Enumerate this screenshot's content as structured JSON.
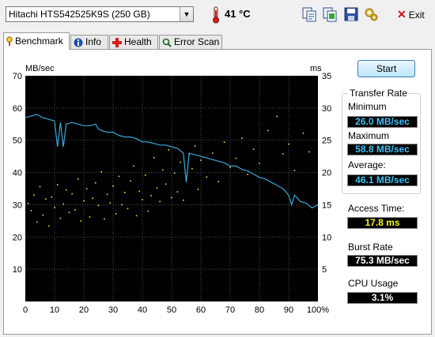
{
  "toolbar": {
    "drive": "Hitachi HTS542525K9S (250 GB)",
    "temperature": "41 °C",
    "icons": [
      "copy-text-icon",
      "copy-screenshot-icon",
      "save-icon",
      "options-icon"
    ],
    "exit_label": "Exit"
  },
  "tabs": [
    {
      "label": "Benchmark",
      "icon": "benchmark-icon",
      "active": true
    },
    {
      "label": "Info",
      "icon": "info-icon",
      "active": false
    },
    {
      "label": "Health",
      "icon": "health-icon",
      "active": false
    },
    {
      "label": "Error Scan",
      "icon": "error-scan-icon",
      "active": false
    }
  ],
  "start_label": "Start",
  "transfer_rate": {
    "title": "Transfer Rate",
    "minimum_label": "Minimum",
    "minimum": "26.0 MB/sec",
    "maximum_label": "Maximum",
    "maximum": "58.8 MB/sec",
    "average_label": "Average:",
    "average": "46.1 MB/sec"
  },
  "access_time_label": "Access Time:",
  "access_time": "17.8 ms",
  "burst_rate_label": "Burst Rate",
  "burst_rate": "75.3 MB/sec",
  "cpu_usage_label": "CPU Usage",
  "cpu_usage": "3.1%",
  "colors": {
    "transfer_line": "#3fa9d8",
    "access_dots": "#e6e62a",
    "plot_background": "#000000",
    "grid": "#2f5a5a"
  },
  "chart_data": {
    "type": "line",
    "xlabel": "",
    "ylabel_left": "MB/sec",
    "ylabel_right": "ms",
    "x_ticks": [
      "0",
      "10",
      "20",
      "30",
      "40",
      "50",
      "60",
      "70",
      "80",
      "90",
      "100%"
    ],
    "y_left_ticks": [
      "10",
      "20",
      "30",
      "40",
      "50",
      "60",
      "70"
    ],
    "y_right_ticks": [
      "5",
      "10",
      "15",
      "20",
      "25",
      "30",
      "35"
    ],
    "xlim": [
      0,
      100
    ],
    "ylim_left": [
      0,
      70
    ],
    "ylim_right": [
      0,
      35
    ],
    "grid": true,
    "series": [
      {
        "kind": "transfer_rate",
        "x": [
          0,
          2,
          4,
          6,
          8,
          10,
          11,
          12,
          13,
          14,
          16,
          18,
          20,
          22,
          24,
          25,
          26,
          28,
          30,
          32,
          34,
          36,
          38,
          40,
          42,
          44,
          46,
          48,
          50,
          52,
          54,
          55,
          56,
          58,
          60,
          62,
          64,
          66,
          68,
          70,
          72,
          74,
          76,
          78,
          80,
          82,
          84,
          86,
          88,
          90,
          91,
          92,
          94,
          96,
          98,
          100
        ],
        "y": [
          57,
          57.5,
          58,
          57,
          56.5,
          56,
          48,
          55.5,
          48,
          55,
          55.5,
          55,
          54.5,
          54.5,
          55,
          53.5,
          53,
          52.5,
          52.5,
          51.5,
          51,
          51,
          50.5,
          49.5,
          49.5,
          49,
          48.5,
          48.5,
          48,
          47.5,
          46,
          37,
          46,
          45.5,
          45,
          44.5,
          44,
          43.5,
          43,
          42,
          42,
          41,
          40.5,
          39.5,
          38.5,
          38,
          37,
          36,
          35,
          33,
          30,
          33,
          31,
          30.5,
          29,
          30
        ]
      },
      {
        "kind": "access_time_samples",
        "points": [
          [
            1,
            15.2
          ],
          [
            2,
            14.1
          ],
          [
            3,
            16.5
          ],
          [
            4,
            12.3
          ],
          [
            5,
            17.8
          ],
          [
            6,
            13.4
          ],
          [
            7,
            15.9
          ],
          [
            8,
            11.7
          ],
          [
            9,
            16.2
          ],
          [
            10,
            14.6
          ],
          [
            11,
            18.1
          ],
          [
            12,
            12.9
          ],
          [
            13,
            15.1
          ],
          [
            14,
            17.3
          ],
          [
            15,
            13.8
          ],
          [
            16,
            16.7
          ],
          [
            17,
            14.2
          ],
          [
            18,
            19.0
          ],
          [
            19,
            12.5
          ],
          [
            20,
            15.6
          ],
          [
            21,
            17.5
          ],
          [
            22,
            13.1
          ],
          [
            23,
            16.0
          ],
          [
            24,
            18.4
          ],
          [
            25,
            14.9
          ],
          [
            26,
            20.1
          ],
          [
            27,
            12.8
          ],
          [
            28,
            16.6
          ],
          [
            29,
            15.3
          ],
          [
            30,
            17.9
          ],
          [
            31,
            13.6
          ],
          [
            32,
            19.4
          ],
          [
            33,
            15.0
          ],
          [
            34,
            16.9
          ],
          [
            35,
            14.4
          ],
          [
            36,
            18.7
          ],
          [
            37,
            21.0
          ],
          [
            38,
            13.3
          ],
          [
            39,
            17.1
          ],
          [
            40,
            15.8
          ],
          [
            41,
            19.6
          ],
          [
            42,
            14.0
          ],
          [
            43,
            16.4
          ],
          [
            44,
            22.3
          ],
          [
            45,
            17.6
          ],
          [
            46,
            15.5
          ],
          [
            47,
            20.4
          ],
          [
            48,
            18.2
          ],
          [
            49,
            23.5
          ],
          [
            50,
            16.1
          ],
          [
            51,
            19.9
          ],
          [
            52,
            17.0
          ],
          [
            53,
            21.6
          ],
          [
            54,
            15.7
          ],
          [
            55,
            18.9
          ],
          [
            56,
            22.8
          ],
          [
            57,
            20.6
          ],
          [
            58,
            24.1
          ],
          [
            59,
            17.4
          ],
          [
            60,
            21.9
          ],
          [
            62,
            19.3
          ],
          [
            64,
            23.0
          ],
          [
            66,
            18.6
          ],
          [
            68,
            24.7
          ],
          [
            70,
            20.8
          ],
          [
            72,
            22.2
          ],
          [
            74,
            25.3
          ],
          [
            76,
            19.7
          ],
          [
            78,
            23.6
          ],
          [
            80,
            21.4
          ],
          [
            83,
            26.5
          ],
          [
            86,
            28.7
          ],
          [
            88,
            22.9
          ],
          [
            90,
            24.4
          ],
          [
            92,
            20.3
          ],
          [
            95,
            26.1
          ],
          [
            97,
            23.2
          ]
        ]
      }
    ]
  }
}
